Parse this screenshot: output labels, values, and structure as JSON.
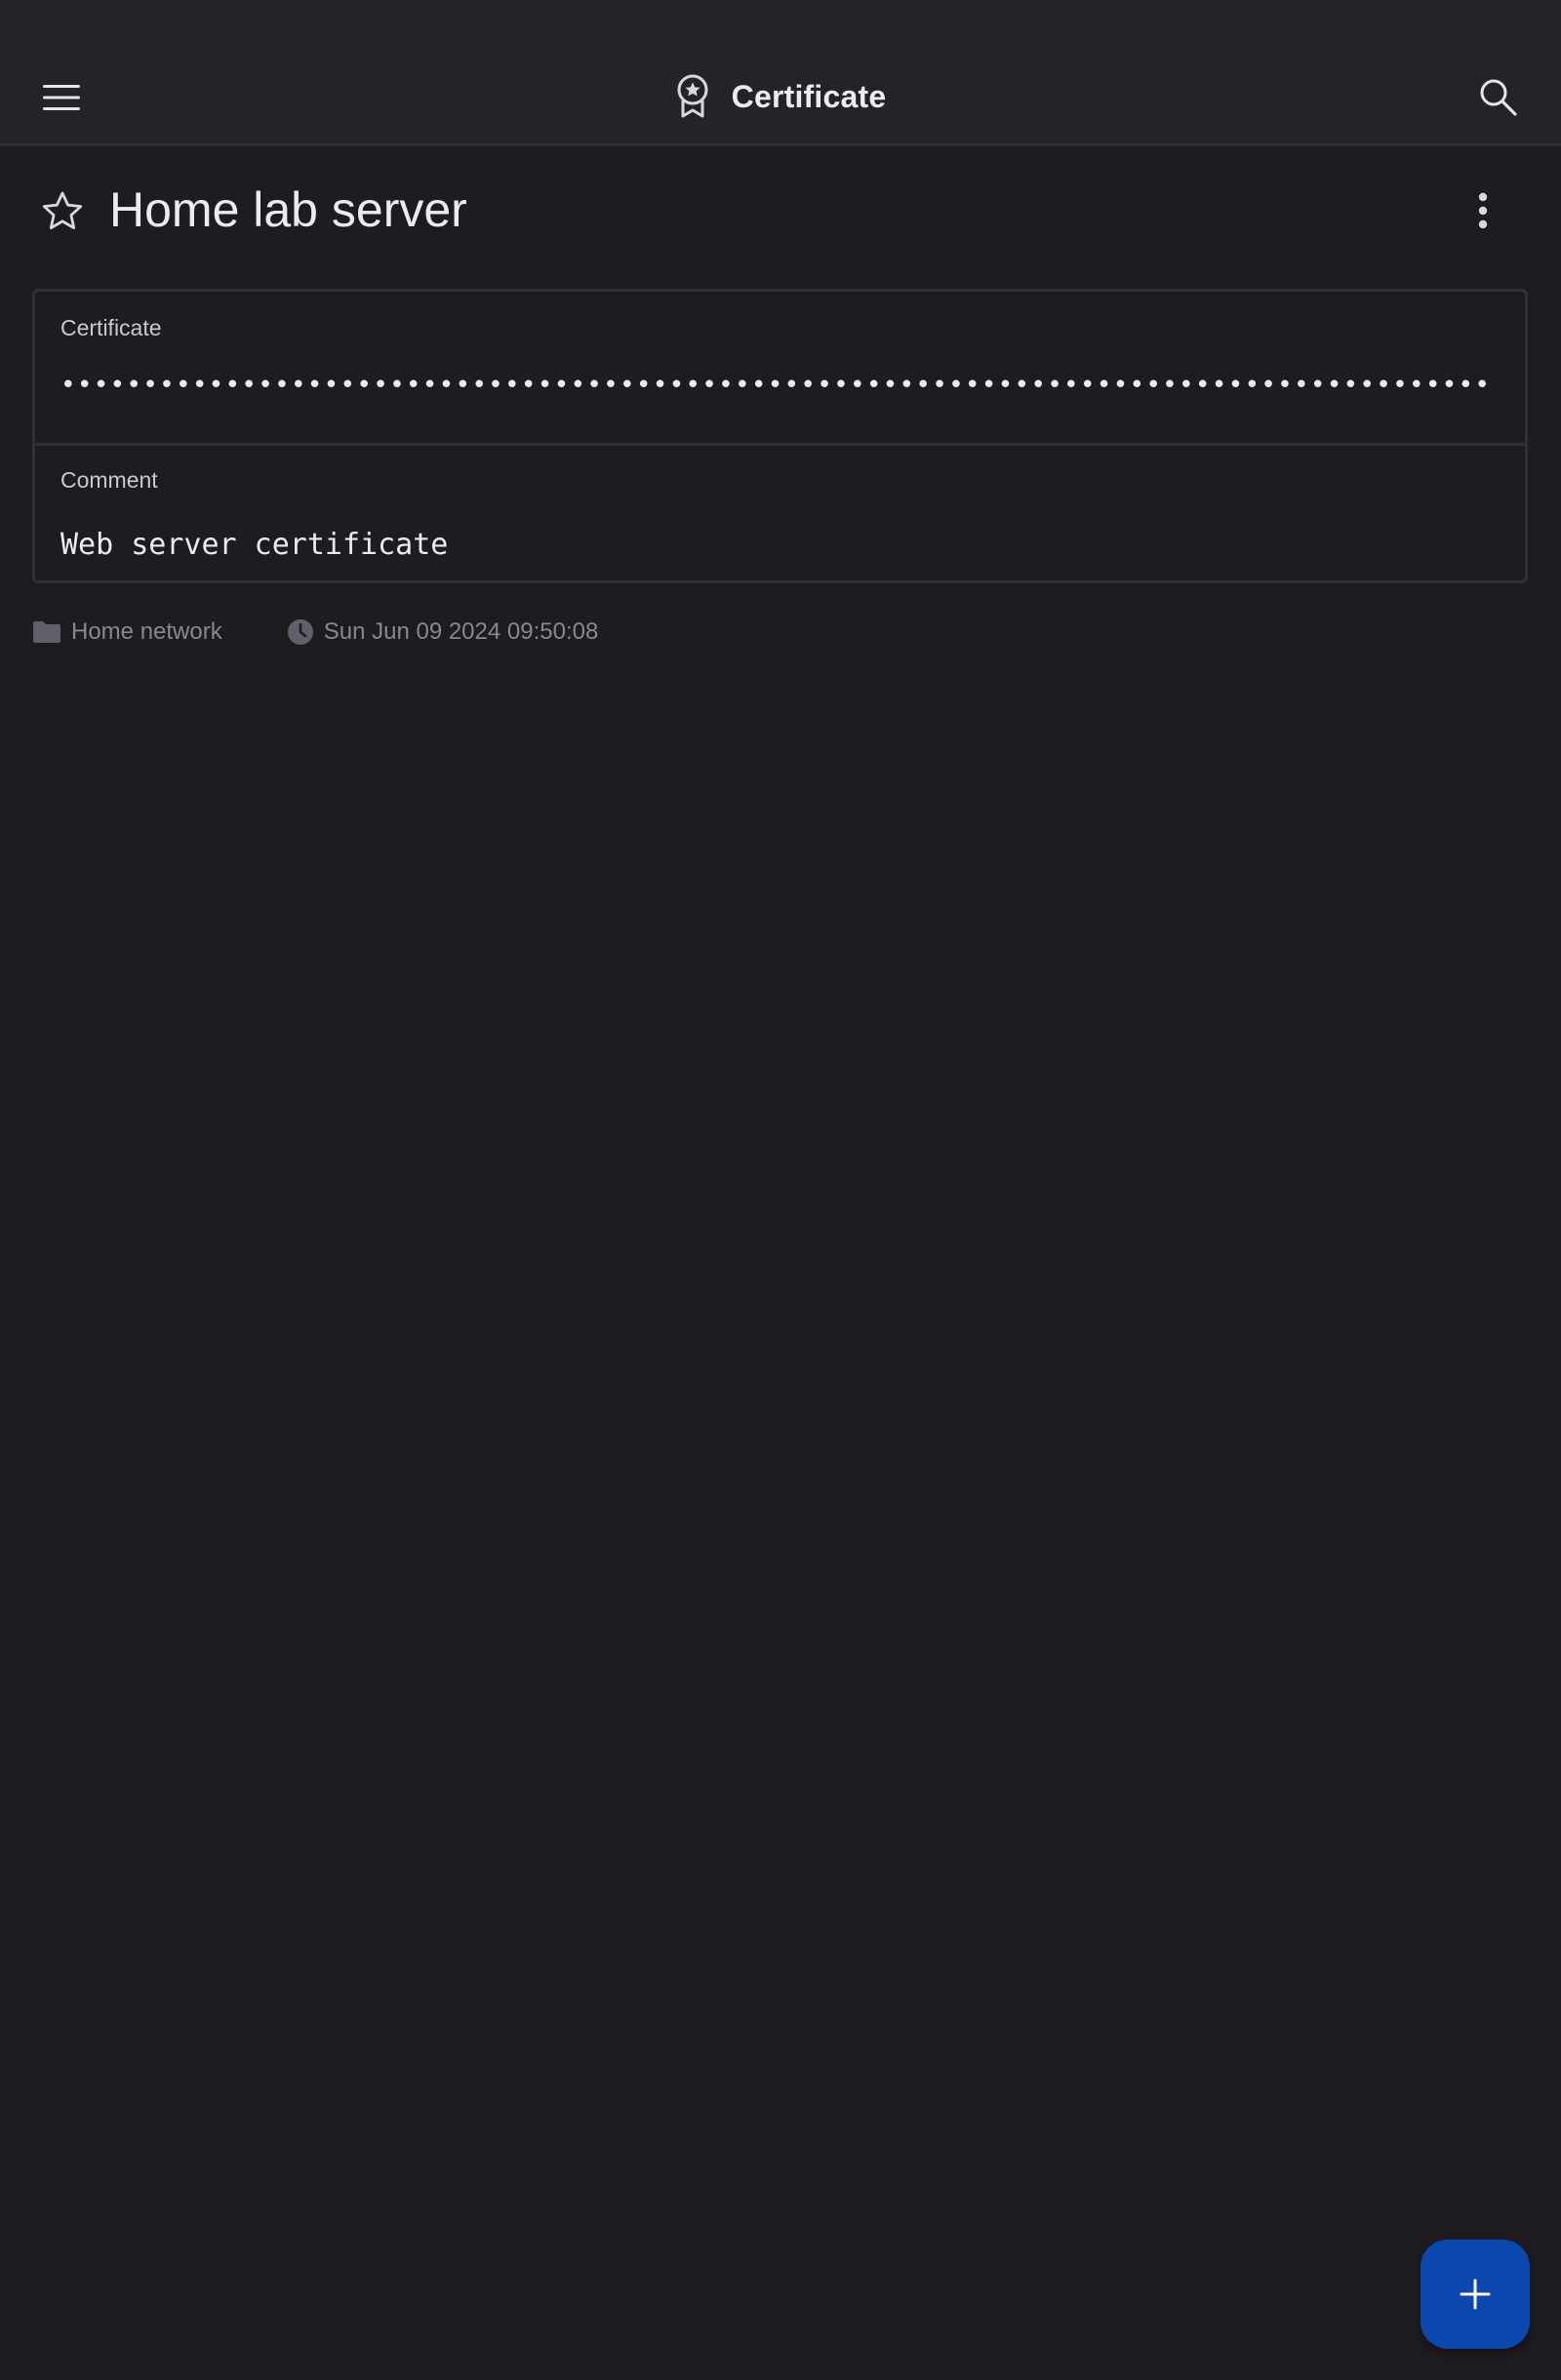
{
  "app_bar": {
    "title": "Certificate",
    "menu_icon": "hamburger-menu-icon",
    "title_icon": "certificate-badge-icon",
    "search_icon": "search-icon"
  },
  "entry": {
    "title": "Home lab server",
    "favorite_icon": "star-outline-icon",
    "more_icon": "more-vertical-icon"
  },
  "fields": {
    "certificate": {
      "label": "Certificate",
      "value_masked": "•••••••••••••••••••••••••••••••••••••••••••••••••••••••••••••••••••••••••••••••••••••••"
    },
    "comment": {
      "label": "Comment",
      "value": "Web server certificate"
    }
  },
  "meta": {
    "folder": "Home network",
    "folder_icon": "folder-icon",
    "modified": "Sun Jun 09 2024 09:50:08",
    "modified_icon": "clock-icon"
  },
  "fab": {
    "icon": "plus-icon"
  },
  "colors": {
    "background": "#1c1c21",
    "app_bar": "#232429",
    "card_border": "#303137",
    "text_primary": "#ececf0",
    "text_muted": "#878891",
    "fab": "#0b47ad"
  }
}
